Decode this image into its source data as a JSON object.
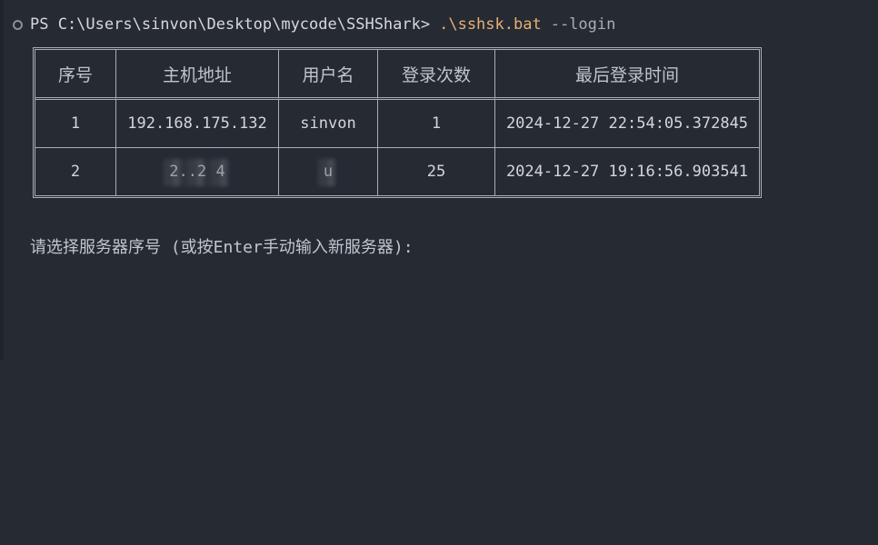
{
  "prompt": {
    "path": "PS C:\\Users\\sinvon\\Desktop\\mycode\\SSHShark>",
    "command": ".\\sshsk.bat",
    "argument": "--login"
  },
  "table": {
    "headers": [
      "序号",
      "主机地址",
      "用户名",
      "登录次数",
      "最后登录时间"
    ],
    "rows": [
      {
        "id": "1",
        "host": "192.168.175.132",
        "user": "sinvon",
        "count": "1",
        "time": "2024-12-27 22:54:05.372845"
      },
      {
        "id": "2",
        "host": "2..2 4",
        "user": "u",
        "count": "25",
        "time": "2024-12-27 19:16:56.903541"
      }
    ]
  },
  "select_prompt": "请选择服务器序号 (或按Enter手动输入新服务器):"
}
